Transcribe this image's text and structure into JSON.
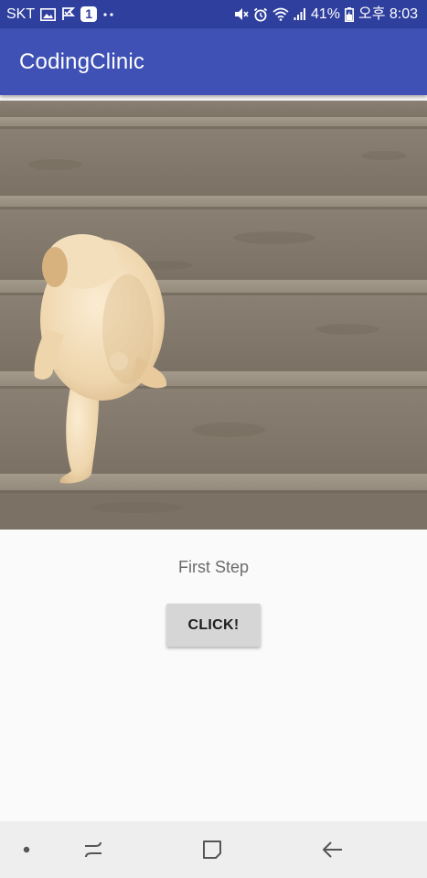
{
  "status_bar": {
    "carrier": "SKT",
    "notification_count": "1",
    "battery_percent": "41%",
    "time": "오후 8:03",
    "icons": [
      "image-icon",
      "check-flag-icon",
      "more-dots-icon",
      "mute-icon",
      "alarm-icon",
      "wifi-icon",
      "signal-icon",
      "battery-icon"
    ]
  },
  "app_bar": {
    "title": "CodingClinic"
  },
  "main": {
    "image": "puppy-climbing-stairs-photo",
    "caption": "First Step",
    "button_label": "CLICK!"
  },
  "nav_bar": {
    "icons": [
      "dot-icon",
      "recents-icon",
      "home-icon",
      "back-icon"
    ]
  },
  "colors": {
    "status_bar": "#2f3f9e",
    "app_bar": "#3f51b5",
    "background": "#fafafa",
    "button": "#d6d6d6",
    "caption_text": "#6b6b6b",
    "nav_bar": "#eeeeee"
  }
}
